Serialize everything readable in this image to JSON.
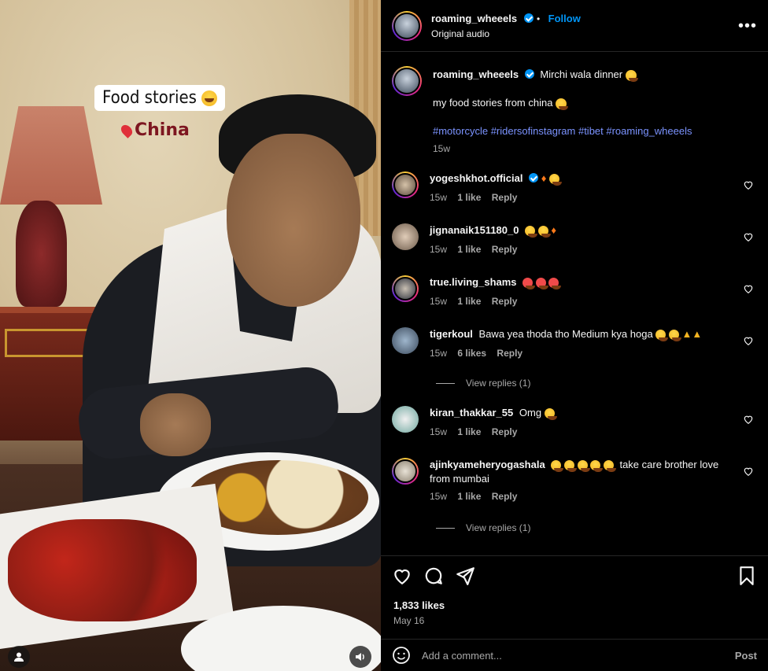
{
  "media": {
    "story_text": "Food stories",
    "location_text": "China"
  },
  "header": {
    "username": "roaming_wheeels",
    "follow_label": "Follow",
    "audio_label": "Original audio",
    "more_icon": "more-horizontal-icon"
  },
  "caption": {
    "username": "roaming_wheeels",
    "title": "Mirchi wala dinner",
    "line2": "my food stories from china",
    "hashtags": "#motorcycle #ridersofinstagram #tibet #roaming_wheeels",
    "time": "15w"
  },
  "comments": [
    {
      "username": "yogeshkhot.official",
      "verified": true,
      "text": "",
      "time": "15w",
      "likes": "1 like",
      "reply": "Reply"
    },
    {
      "username": "jignanaik151180_0",
      "verified": false,
      "text": "",
      "time": "15w",
      "likes": "1 like",
      "reply": "Reply"
    },
    {
      "username": "true.living_shams",
      "verified": false,
      "text": "",
      "time": "15w",
      "likes": "1 like",
      "reply": "Reply"
    },
    {
      "username": "tigerkoul",
      "verified": false,
      "text": "Bawa yea thoda tho Medium kya hoga",
      "time": "15w",
      "likes": "6 likes",
      "reply": "Reply",
      "view_replies": "View replies (1)"
    },
    {
      "username": "kiran_thakkar_55",
      "verified": false,
      "text": "Omg",
      "time": "15w",
      "likes": "1 like",
      "reply": "Reply"
    },
    {
      "username": "ajinkyameheryogashala",
      "verified": false,
      "text": "take care brother love",
      "text2": "from mumbai",
      "time": "15w",
      "likes": "1 like",
      "reply": "Reply",
      "view_replies": "View replies (1)"
    }
  ],
  "footer": {
    "likes": "1,833 likes",
    "date": "May 16",
    "add_comment_placeholder": "Add a comment...",
    "post_label": "Post"
  },
  "colors": {
    "accent": "#0095f6",
    "hashtag": "#7b93ff",
    "muted": "#a8a8a8",
    "background": "#000000"
  }
}
